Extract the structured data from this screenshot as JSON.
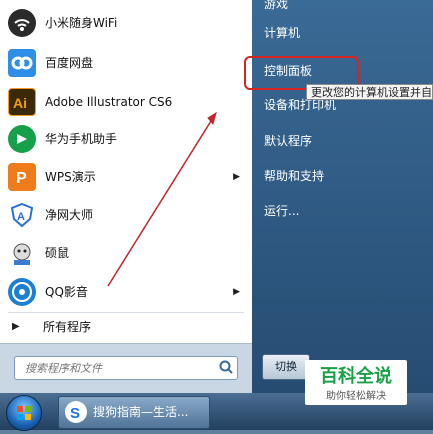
{
  "start_menu": {
    "programs": [
      {
        "label": "小米随身WiFi",
        "icon": "wifi-icon",
        "color": "#2b2b2b",
        "has_submenu": false
      },
      {
        "label": "百度网盘",
        "icon": "baidu-netdisk-icon",
        "color": "#2f8ee8",
        "has_submenu": false
      },
      {
        "label": "Adobe Illustrator CS6",
        "icon": "adobe-illustrator-icon",
        "color": "#3a2a0b",
        "has_submenu": false
      },
      {
        "label": "华为手机助手",
        "icon": "huawei-assistant-icon",
        "color": "#16a04a",
        "has_submenu": false
      },
      {
        "label": "WPS演示",
        "icon": "wps-presentation-icon",
        "color": "#f07b1b",
        "has_submenu": true
      },
      {
        "label": "净网大师",
        "icon": "shield-icon",
        "color": "#2a6fd6",
        "has_submenu": false
      },
      {
        "label": "硕鼠",
        "icon": "mouse-icon",
        "color": "#9a8a7a",
        "has_submenu": false
      },
      {
        "label": "QQ影音",
        "icon": "qq-player-icon",
        "color": "#1d7fd2",
        "has_submenu": true
      }
    ],
    "all_programs": "所有程序",
    "search_placeholder": "搜索程序和文件",
    "right_items": [
      "游戏",
      "计算机",
      "控制面板",
      "设备和打印机",
      "默认程序",
      "帮助和支持",
      "运行..."
    ],
    "shutdown_label": "切换"
  },
  "tooltip": "更改您的计算机设置并自",
  "taskbar": {
    "button_label": "搜狗指南—生活..."
  },
  "watermark": {
    "title": "百科全说",
    "subtitle": "助你轻松解决"
  },
  "accent_colors": {
    "highlight": "#d82323",
    "arrow": "#c0272d"
  }
}
